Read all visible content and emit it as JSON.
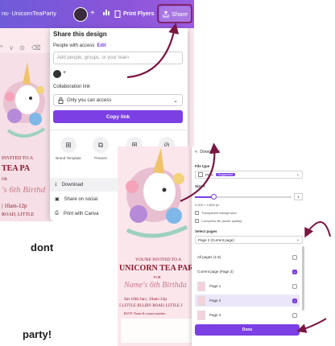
{
  "canva_share": {
    "document_title": "ns- UnicornTeaParty",
    "toolbar": {
      "plus": "+",
      "chart_icon": "bar-chart-icon",
      "print_label": "Print Flyers",
      "share_label": "Share"
    },
    "canvas_controls": "^ v ⊙ ⌫",
    "share_panel": {
      "title": "Share this design",
      "people_label": "People with access",
      "edit_label": "Edit",
      "input_placeholder": "Add people, groups, or your team",
      "user_plus": "+",
      "collab_label": "Collaboration link",
      "access_value": "Only you can access",
      "copy_link": "Copy link",
      "options": [
        {
          "icon": "brand-template-icon",
          "glyph": "⊞",
          "label": "Brand Template"
        },
        {
          "icon": "present-icon",
          "glyph": "⧉",
          "label": "Present"
        },
        {
          "icon": "template-link-icon",
          "glyph": "⊞",
          "label": "Template link"
        },
        {
          "icon": "public-view-link-icon",
          "glyph": "⊘",
          "label": "Public view link"
        }
      ],
      "rows": [
        {
          "icon": "download-icon",
          "glyph": "⤓",
          "label": "Download"
        },
        {
          "icon": "social-icon",
          "glyph": "▣",
          "label": "Share on social"
        },
        {
          "icon": "print-icon",
          "glyph": "⎙",
          "label": "Print with Canva"
        }
      ]
    },
    "flyer": {
      "invited": "INVITED TO A",
      "tea": "TEA PA",
      "for": "OR",
      "birthday": "'s 6th Birthd",
      "date": "| 10am-12p",
      "address": "ROAD, LITTLE"
    }
  },
  "page_text": {
    "line1": "dont",
    "line2": "party!"
  },
  "canva_download": {
    "flyer": {
      "invited": "YOU'RE INVITED TO A",
      "title": "UNICORN TEA PAR",
      "for": "FOR",
      "name": "Name's 6th Birthda",
      "date": "Sat 10th Jan  |  10am-12p",
      "address": "5 LITTLE JILLIBY ROAD, LITTLE J",
      "rsvp": "RSVP: Name & contact number"
    },
    "panel": {
      "back": "<",
      "title": "Download",
      "file_type_label": "File type",
      "file_type_value": "PNG",
      "suggested": "Suggested",
      "size_label": "Size ×",
      "size_value": "1",
      "dims": "2,000 × 2,828 px",
      "transparent": "Transparent background",
      "compress": "Compress file (lower quality)",
      "select_pages_label": "Select pages",
      "pages_value": "Page 2 (Current page)",
      "all_pages": "All pages (1-5)",
      "current_page": "Current page (Page 2)",
      "pages": [
        {
          "label": "Page 1",
          "checked": false
        },
        {
          "label": "Page 2",
          "checked": true
        },
        {
          "label": "Page 3",
          "checked": false
        }
      ],
      "done": "Done"
    }
  }
}
